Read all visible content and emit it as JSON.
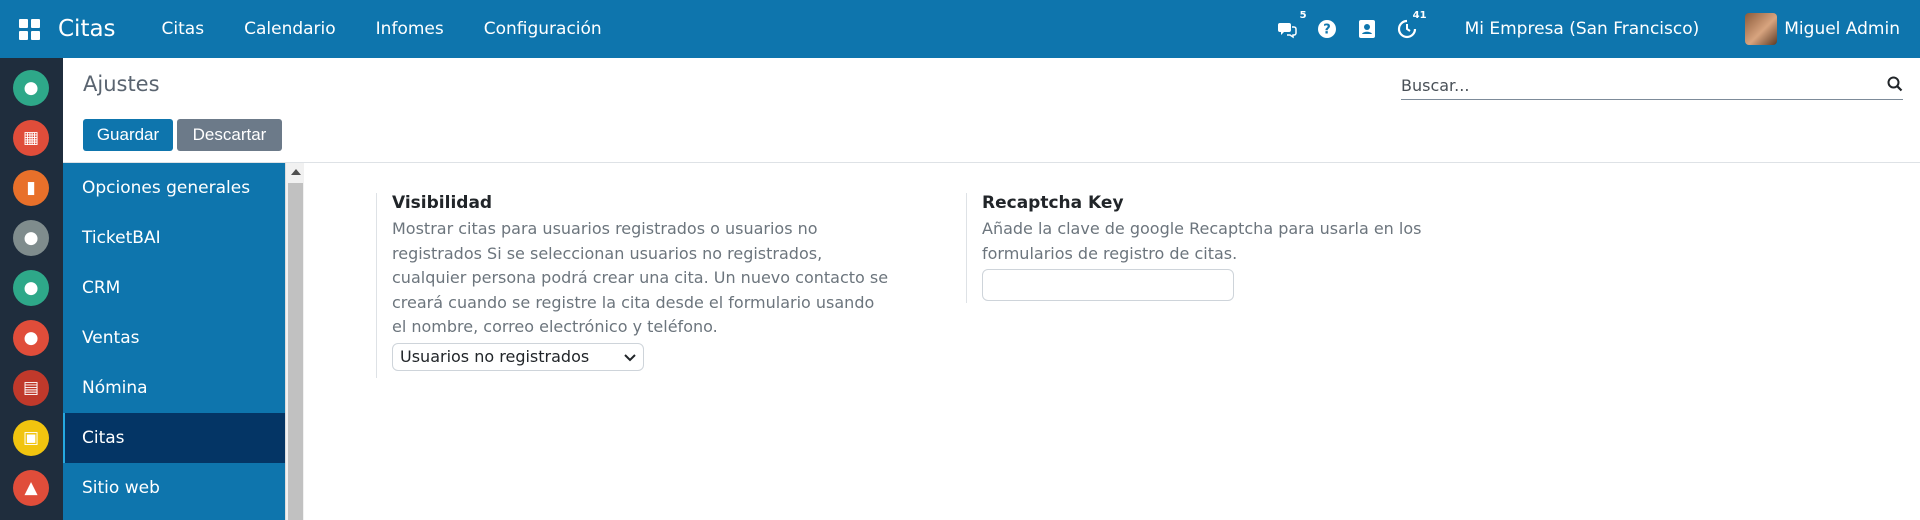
{
  "topbar": {
    "app_title": "Citas",
    "menu": [
      "Citas",
      "Calendario",
      "Infomes",
      "Configuración"
    ],
    "messages_count": "5",
    "activities_count": "41",
    "company": "Mi Empresa (San Francisco)",
    "user": "Miguel Admin",
    "icons": [
      "apps-grid-icon",
      "chat-icon",
      "help-icon",
      "contacts-icon",
      "activity-clock-icon"
    ]
  },
  "dock": {
    "colors": [
      "#2ea889",
      "#e04d3a",
      "#e8702a",
      "#7f8c8d",
      "#2ea889",
      "#e04d3a",
      "#c0392b",
      "#f1c40f",
      "#e04d3a"
    ]
  },
  "control": {
    "breadcrumb": "Ajustes",
    "save_label": "Guardar",
    "discard_label": "Descartar",
    "search_placeholder": "Buscar..."
  },
  "sidebar": {
    "items": [
      {
        "label": "Opciones generales"
      },
      {
        "label": "TicketBAI"
      },
      {
        "label": "CRM"
      },
      {
        "label": "Ventas"
      },
      {
        "label": "Nómina"
      },
      {
        "label": "Citas"
      },
      {
        "label": "Sitio web"
      }
    ],
    "active": "Citas"
  },
  "settings": {
    "visibility": {
      "title": "Visibilidad",
      "description": "Mostrar citas para usuarios registrados o usuarios no registrados Si se seleccionan usuarios no registrados, cualquier persona podrá crear una cita. Un nuevo contacto se creará cuando se registre la cita desde el formulario usando el nombre, correo electrónico y teléfono.",
      "selected": "Usuarios no registrados"
    },
    "recaptcha": {
      "title": "Recaptcha Key",
      "description": "Añade la clave de google Recaptcha para usarla en los formularios de registro de citas.",
      "value": ""
    }
  },
  "colors": {
    "brand": "#0e75ad",
    "active_sidebar": "#043565",
    "dock_bg": "#1f2d3d"
  }
}
